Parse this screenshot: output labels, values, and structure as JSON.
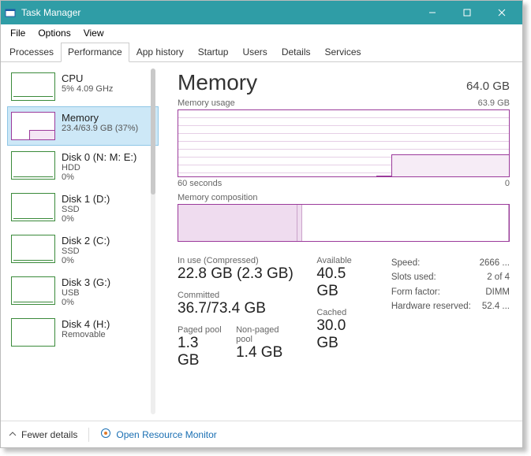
{
  "window": {
    "title": "Task Manager"
  },
  "menu": {
    "file": "File",
    "options": "Options",
    "view": "View"
  },
  "tabs": {
    "processes": "Processes",
    "performance": "Performance",
    "app_history": "App history",
    "startup": "Startup",
    "users": "Users",
    "details": "Details",
    "services": "Services"
  },
  "sidebar": [
    {
      "title": "CPU",
      "sub": "5% 4.09 GHz"
    },
    {
      "title": "Memory",
      "sub": "23.4/63.9 GB (37%)"
    },
    {
      "title": "Disk 0 (N: M: E:)",
      "sub": "HDD",
      "pct": "0%"
    },
    {
      "title": "Disk 1 (D:)",
      "sub": "SSD",
      "pct": "0%"
    },
    {
      "title": "Disk 2 (C:)",
      "sub": "SSD",
      "pct": "0%"
    },
    {
      "title": "Disk 3 (G:)",
      "sub": "USB",
      "pct": "0%"
    },
    {
      "title": "Disk 4 (H:)",
      "sub": "Removable",
      "pct": ""
    }
  ],
  "detail": {
    "title": "Memory",
    "capacity": "64.0 GB",
    "usage_label": "Memory usage",
    "usage_max": "63.9 GB",
    "axis_left": "60 seconds",
    "axis_right": "0",
    "composition_label": "Memory composition",
    "in_use_label": "In use (Compressed)",
    "in_use_val": "22.8 GB (2.3 GB)",
    "available_label": "Available",
    "available_val": "40.5 GB",
    "committed_label": "Committed",
    "committed_val": "36.7/73.4 GB",
    "cached_label": "Cached",
    "cached_val": "30.0 GB",
    "paged_label": "Paged pool",
    "paged_val": "1.3 GB",
    "nonpaged_label": "Non-paged pool",
    "nonpaged_val": "1.4 GB",
    "kv": {
      "speed_k": "Speed:",
      "speed_v": "2666 ...",
      "slots_k": "Slots used:",
      "slots_v": "2 of 4",
      "form_k": "Form factor:",
      "form_v": "DIMM",
      "hw_k": "Hardware reserved:",
      "hw_v": "52.4 ..."
    }
  },
  "footer": {
    "fewer": "Fewer details",
    "orm": "Open Resource Monitor"
  },
  "chart_data": {
    "type": "line",
    "title": "Memory usage",
    "xlabel": "seconds ago",
    "ylabel": "GB",
    "ylim": [
      0,
      63.9
    ],
    "x": [
      60,
      50,
      40,
      30,
      22,
      20,
      10,
      0
    ],
    "values": [
      0,
      0,
      0,
      0,
      0,
      23.4,
      23.4,
      23.4
    ]
  }
}
